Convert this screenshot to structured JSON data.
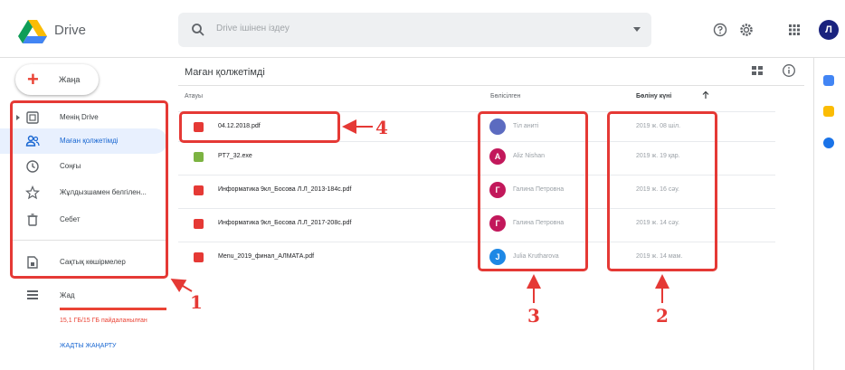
{
  "app": {
    "name": "Drive"
  },
  "search": {
    "placeholder": "Drive ішінен іздеу",
    "icon": "search-icon"
  },
  "topbar_icons": [
    "help-icon",
    "settings-icon",
    "apps-grid-icon"
  ],
  "user": {
    "avatar_letter": "Л",
    "avatar_color": "#1a237e"
  },
  "new_button": {
    "label": "Жаңа"
  },
  "sidebar": {
    "items": [
      {
        "label": "Менің Drive",
        "icon": "my-drive-icon"
      },
      {
        "label": "Маған қолжетімді",
        "icon": "shared-people-icon",
        "active": true
      },
      {
        "label": "Соңғы",
        "icon": "clock-icon"
      },
      {
        "label": "Жұлдызшамен белгілен...",
        "icon": "star-icon"
      },
      {
        "label": "Себет",
        "icon": "trash-icon"
      },
      {
        "label": "Сақтық көшірмелер",
        "icon": "backup-icon"
      }
    ],
    "storage": {
      "label": "Жад",
      "usage_text": "15,1 ГБ/15 ГБ пайдаланылған",
      "upgrade_link": "ЖАДТЫ ЖАҢАРТУ",
      "used_fraction": 1.0
    }
  },
  "main": {
    "title": "Маған қолжетімді",
    "columns": {
      "name": "Атауы",
      "owner": "Бөлісілген",
      "date": "Бөліну күні"
    },
    "files": [
      {
        "name": "04.12.2018.pdf",
        "type": "pdf",
        "owner": "Тіл аниті",
        "owner_initial": "",
        "owner_color": "#5c6bc0",
        "date": "2019 ж. 08 шіл."
      },
      {
        "name": "PT7_32.exe",
        "type": "exe",
        "owner": "Aliz Nishan",
        "owner_initial": "A",
        "owner_color": "#c2185b",
        "date": "2019 ж. 19 қар."
      },
      {
        "name": "Информатика 9кл_Босова Л.Л_2013-184с.pdf",
        "type": "pdf",
        "owner": "Галина Петровна",
        "owner_initial": "Г",
        "owner_color": "#c2185b",
        "date": "2019 ж. 16 сәу."
      },
      {
        "name": "Информатика 9кл_Босова Л.Л_2017-208с.pdf",
        "type": "pdf",
        "owner": "Галина Петровна",
        "owner_initial": "Г",
        "owner_color": "#c2185b",
        "date": "2019 ж. 14 сәу."
      },
      {
        "name": "Menu_2019_финал_АЛМАТА.pdf",
        "type": "pdf",
        "owner": "Julia Krutharova",
        "owner_initial": "J",
        "owner_color": "#1e88e5",
        "date": "2019 ж. 14 мам."
      }
    ]
  },
  "colors": {
    "accent_red": "#e53935",
    "pdf_red": "#e53935",
    "exe_green": "#7cb342",
    "active_bg": "#e8f0fe",
    "active_text": "#1967d2"
  },
  "annotations": [
    {
      "number": "1"
    },
    {
      "number": "2"
    },
    {
      "number": "3"
    },
    {
      "number": "4"
    }
  ]
}
